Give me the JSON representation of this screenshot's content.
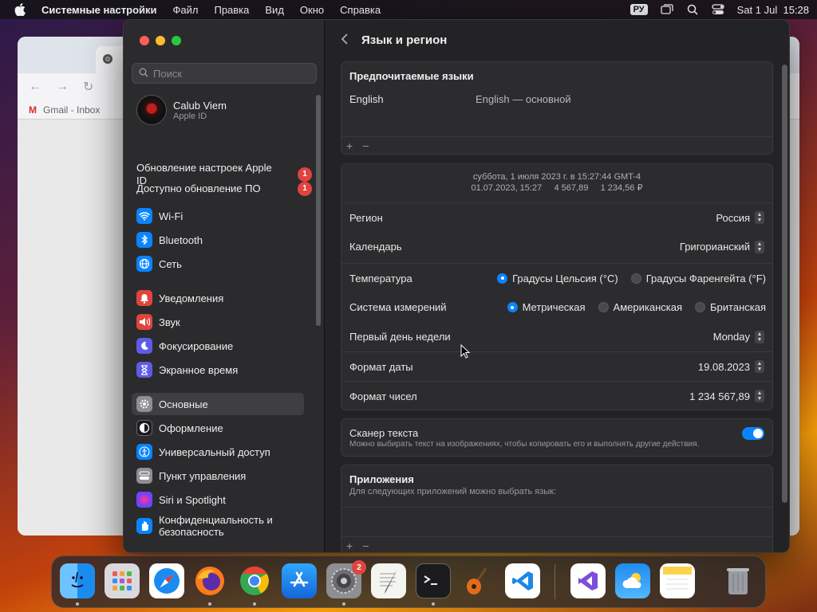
{
  "menubar": {
    "app_name": "Системные настройки",
    "items": [
      "Файл",
      "Правка",
      "Вид",
      "Окно",
      "Справка"
    ],
    "input_source": "РУ",
    "datetime": "Sat 1 Jul  15:28"
  },
  "browser": {
    "bookmark": "Gmail - Inbox"
  },
  "sidebar": {
    "search_placeholder": "Поиск",
    "account": {
      "name": "Calub Viem",
      "sub": "Apple ID"
    },
    "notices": [
      {
        "label": "Обновление настроек Apple ID",
        "badge": "1"
      },
      {
        "label": "Доступно обновление ПО",
        "badge": "1"
      }
    ],
    "items": [
      {
        "label": "Wi-Fi",
        "icon": "wifi-icon",
        "color": "#0a84ff"
      },
      {
        "label": "Bluetooth",
        "icon": "bluetooth-icon",
        "color": "#0a84ff"
      },
      {
        "label": "Сеть",
        "icon": "globe-icon",
        "color": "#0a84ff"
      },
      {
        "label": "Уведомления",
        "icon": "bell-icon",
        "color": "#e0443e"
      },
      {
        "label": "Звук",
        "icon": "speaker-icon",
        "color": "#e0443e"
      },
      {
        "label": "Фокусирование",
        "icon": "moon-icon",
        "color": "#5e5ce6"
      },
      {
        "label": "Экранное время",
        "icon": "hourglass-icon",
        "color": "#5e5ce6"
      },
      {
        "label": "Основные",
        "icon": "gear-icon",
        "color": "#8e8e93"
      },
      {
        "label": "Оформление",
        "icon": "appearance-icon",
        "color": "#1c1c1e"
      },
      {
        "label": "Универсальный доступ",
        "icon": "accessibility-icon",
        "color": "#0a84ff"
      },
      {
        "label": "Пункт управления",
        "icon": "control-center-icon",
        "color": "#8e8e93"
      },
      {
        "label": "Siri и Spotlight",
        "icon": "siri-icon",
        "color": "#7a3cff"
      },
      {
        "label": "Конфиденциальность и безопасность",
        "icon": "hand-icon",
        "color": "#0a84ff"
      }
    ]
  },
  "main": {
    "title": "Язык и регион",
    "languages": {
      "heading": "Предпочитаемые языки",
      "name": "English",
      "desc": "English — основной"
    },
    "preview": {
      "line1": "суббота, 1 июля 2023 г. в 15:27:44 GMT-4",
      "line2": "01.07.2023, 15:27     4 567,89     1 234,56 ₽"
    },
    "rows": {
      "region": {
        "label": "Регион",
        "value": "Россия"
      },
      "calendar": {
        "label": "Календарь",
        "value": "Григорианский"
      },
      "temperature": {
        "label": "Температура",
        "opt1": "Градусы Цельсия (°C)",
        "opt2": "Градусы Фаренгейта (°F)"
      },
      "measure": {
        "label": "Система измерений",
        "opt1": "Метрическая",
        "opt2": "Американская",
        "opt3": "Британская"
      },
      "first_day": {
        "label": "Первый день недели",
        "value": "Monday"
      },
      "date_format": {
        "label": "Формат даты",
        "value": "19.08.2023"
      },
      "number_format": {
        "label": "Формат чисел",
        "value": "1 234 567,89"
      }
    },
    "live_text": {
      "title": "Сканер текста",
      "desc": "Можно выбирать текст на изображениях, чтобы копировать его и выполнять другие действия.",
      "enabled": true
    },
    "apps": {
      "heading": "Приложения",
      "desc": "Для следующих приложений можно выбрать язык:"
    },
    "plus": "+",
    "minus": "−"
  },
  "dock": {
    "settings_badge": "2",
    "apps": [
      "Finder",
      "Launchpad",
      "Safari",
      "Firefox",
      "Chrome",
      "App Store",
      "System Settings",
      "TextEdit",
      "Terminal",
      "GarageBand",
      "VS Code",
      "Visual Studio",
      "Weather",
      "Notes",
      "Trash"
    ]
  }
}
